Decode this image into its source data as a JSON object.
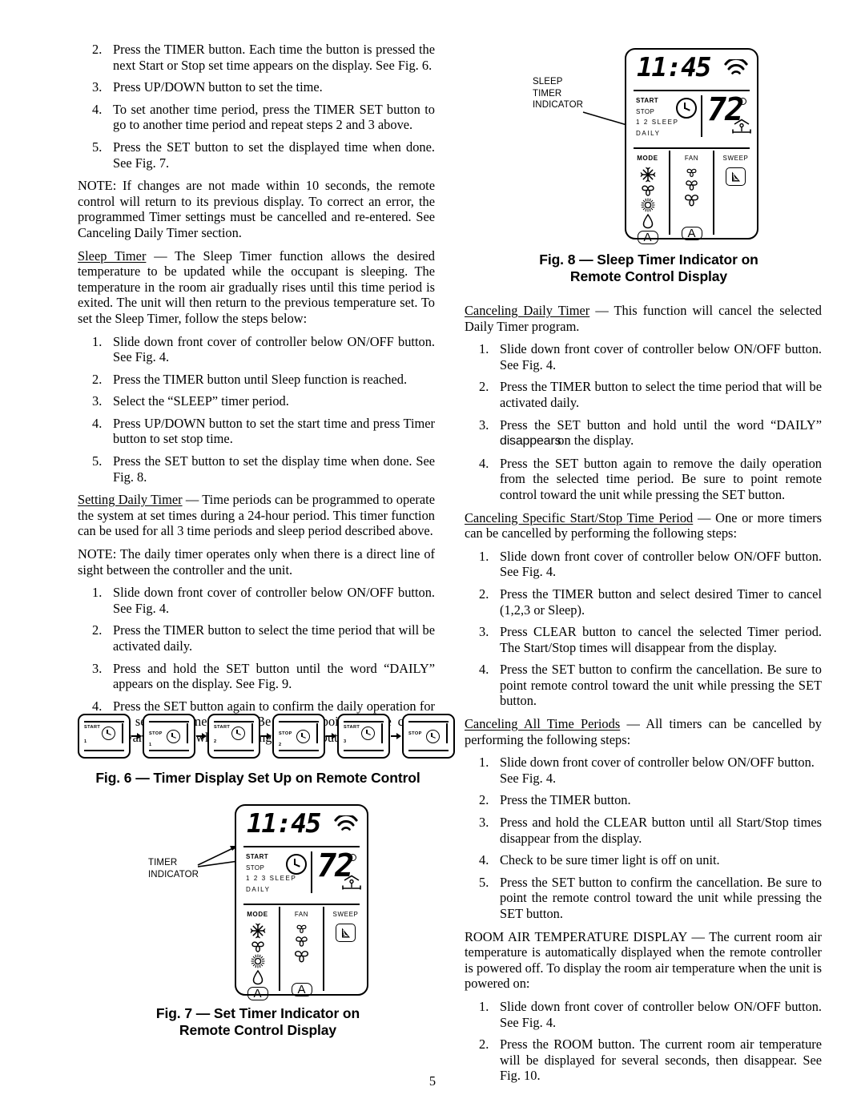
{
  "page": {
    "number": "5"
  },
  "left_column": {
    "steps_timer_setup": [
      {
        "num": "2.",
        "text": "Press the TIMER button. Each time the button is pressed the next Start or Stop set time appears on the display. See Fig. 6."
      },
      {
        "num": "3.",
        "text": "Press UP/DOWN button to set the time."
      },
      {
        "num": "4.",
        "text": "To set another time period, press the TIMER SET button to go to another time period and repeat steps 2 and 3 above."
      },
      {
        "num": "5.",
        "text": "Press the SET button to set the displayed time when done. See Fig. 7."
      }
    ],
    "note_1": "NOTE: If changes are not made within 10 seconds, the remote control will return to its previous display. To correct an error, the programmed Timer settings must be cancelled and re-entered. See Canceling Daily Timer section.",
    "sleep_timer_heading": "Sleep Timer",
    "sleep_timer_body": " — The Sleep Timer function allows the desired temperature to be updated while the occupant is sleeping. The temperature in the room air gradually rises until this time period is exited. The unit will then return to the previous temperature set. To set the Sleep Timer, follow the steps below:",
    "steps_sleep": [
      {
        "num": "1.",
        "text": "Slide down front cover of controller below ON/OFF button. See Fig. 4."
      },
      {
        "num": "2.",
        "text": "Press the TIMER button until Sleep function is reached."
      },
      {
        "num": "3.",
        "text": "Select the “SLEEP” timer period."
      },
      {
        "num": "4.",
        "text": "Press UP/DOWN button to set the start time and press Timer button to set stop time."
      },
      {
        "num": "5.",
        "text": "Press the SET button to set the display time when done. See Fig. 8."
      }
    ],
    "setting_daily_heading": "Setting Daily Timer",
    "setting_daily_body": " — Time periods can be programmed to operate the system at set times during a 24-hour period. This timer function can be used for all 3 time periods and sleep period described above.",
    "note_2": "NOTE: The daily timer operates only when there is a direct line of sight between the controller and the unit.",
    "steps_daily": [
      {
        "num": "1.",
        "text": "Slide down front cover of controller below ON/OFF button. See Fig. 4."
      },
      {
        "num": "2.",
        "text": "Press the TIMER button to select the time period that will be activated daily."
      },
      {
        "num": "3.",
        "text": "Press and hold the SET button until the word “DAILY” appears on the display. See Fig. 9."
      },
      {
        "num": "4.",
        "text": "Press the SET button again to confirm the daily operation for the selected time period. Be sure to point remote control toward the unit while pressing the SET button."
      }
    ]
  },
  "right_column": {
    "canceling_daily_heading": "Canceling Daily Timer",
    "canceling_daily_body": " — This function will cancel the selected Daily Timer program.",
    "steps_cancel_daily": [
      {
        "num": "1.",
        "text": "Slide down front cover of controller below ON/OFF button. See Fig. 4."
      },
      {
        "num": "2.",
        "text": "Press the TIMER button to select the time period that will be activated daily."
      },
      {
        "num": "3.",
        "text": "Press the SET button and hold until the word “DAILY”",
        "text2_sans": "disappears",
        "text2_serif": "on the display."
      },
      {
        "num": "4.",
        "text": "Press the SET button again to remove the daily operation from the selected time period. Be sure to point remote control toward the unit while pressing the SET button."
      }
    ],
    "canceling_specific_heading": "Canceling Specific Start/Stop Time Period",
    "canceling_specific_body": " — One or more timers can be cancelled by performing the following steps:",
    "steps_cancel_specific": [
      {
        "num": "1.",
        "text": "Slide down front cover of controller below ON/OFF button. See Fig. 4."
      },
      {
        "num": "2.",
        "text": "Press the TIMER button and select desired Timer to cancel (1,2,3 or Sleep)."
      },
      {
        "num": "3.",
        "text": "Press CLEAR button to cancel the selected Timer period. The Start/Stop times will disappear from the display."
      },
      {
        "num": "4.",
        "text": "Press the SET button to confirm the cancellation. Be sure to point remote control toward the unit while pressing the SET button."
      }
    ],
    "canceling_all_heading": "Canceling All Time Periods",
    "canceling_all_body": " — All timers can be cancelled by performing the following steps:",
    "steps_cancel_all": [
      {
        "num": "1.",
        "text": "Slide down front cover of controller below ON/OFF button. See Fig. 4."
      },
      {
        "num": "2.",
        "text": "Press the TIMER button."
      },
      {
        "num": "3.",
        "text": "Press and hold the CLEAR button until all Start/Stop times disappear from the display."
      },
      {
        "num": "4.",
        "text": "Check to be sure timer light is off on unit."
      },
      {
        "num": "5.",
        "text": "Press the SET button to confirm the cancellation. Be sure to point the remote control toward the unit while pressing the SET button."
      }
    ],
    "room_air_heading": "ROOM AIR TEMPERATURE DISPLAY",
    "room_air_body": " — The current room air temperature is automatically displayed when the remote controller is powered off. To display the room air temperature when the unit is powered on:",
    "steps_room_air": [
      {
        "num": "1.",
        "text": "Slide down front cover of controller below ON/OFF button. See Fig. 4."
      },
      {
        "num": "2.",
        "text": "Press the ROOM button. The current room air temperature will be displayed for several seconds, then disappear. See Fig. 10."
      }
    ]
  },
  "fig6": {
    "caption": "Fig. 6 — Timer Display Set Up on Remote Control",
    "boxes": [
      {
        "label": "START",
        "index": "1"
      },
      {
        "label": "STOP",
        "index": "1"
      },
      {
        "label": "START",
        "index": "2"
      },
      {
        "label": "STOP",
        "index": "2"
      },
      {
        "label": "START",
        "index": "3"
      },
      {
        "label": "STOP",
        "index": ""
      }
    ]
  },
  "fig7": {
    "caption_line1": "Fig. 7 — Set Timer Indicator on",
    "caption_line2": "Remote Control Display",
    "callout_lines": [
      "TIMER",
      "INDICATOR"
    ],
    "display": {
      "time": "11:45",
      "temperature": "72",
      "timer_rows": [
        "START",
        "STOP",
        "1  2  3  SLEEP",
        "DAILY"
      ],
      "columns": [
        {
          "header": "MODE",
          "icons": [
            "snowflake-icon",
            "fan-icon",
            "sun-icon",
            "droplet-icon",
            "auto-icon"
          ],
          "auto_label": "A"
        },
        {
          "header": "FAN",
          "icons": [
            "fan-small-icon",
            "fan-medium-icon",
            "fan-large-icon",
            "auto-icon"
          ],
          "auto_label": "A"
        },
        {
          "header": "SWEEP",
          "icons": [
            "louver-sweep-icon"
          ]
        }
      ]
    }
  },
  "fig8": {
    "caption_line1": "Fig. 8 — Sleep Timer Indicator on",
    "caption_line2": "Remote Control Display",
    "callout_lines": [
      "SLEEP",
      "TIMER",
      "INDICATOR"
    ],
    "display": {
      "time": "11:45",
      "temperature": "72",
      "timer_rows": [
        "START",
        "STOP",
        "1  2   SLEEP",
        "DAILY"
      ],
      "columns": [
        {
          "header": "MODE",
          "icons": [
            "snowflake-icon",
            "fan-icon",
            "sun-icon",
            "droplet-icon",
            "auto-icon"
          ],
          "auto_label": "A"
        },
        {
          "header": "FAN",
          "icons": [
            "fan-small-icon",
            "fan-medium-icon",
            "fan-large-icon",
            "auto-icon"
          ],
          "auto_label": "A"
        },
        {
          "header": "SWEEP",
          "icons": [
            "louver-sweep-icon"
          ]
        }
      ]
    }
  }
}
